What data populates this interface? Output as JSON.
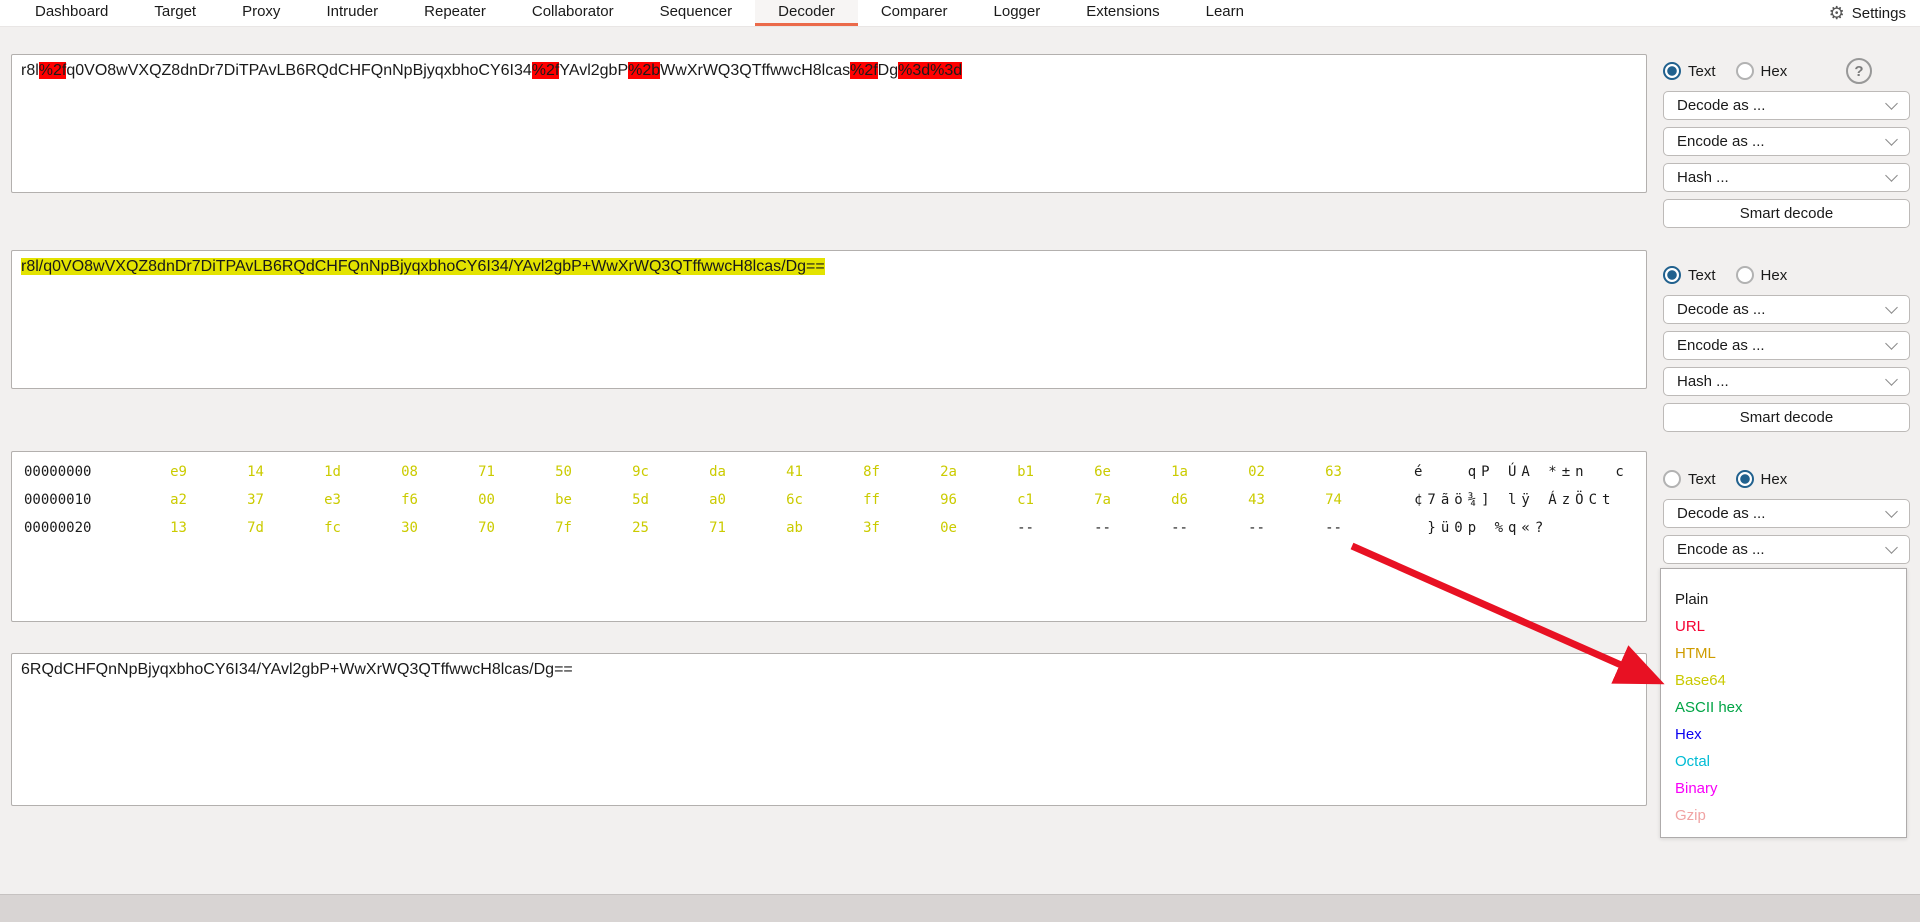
{
  "navbar": {
    "tabs": [
      {
        "label": "Dashboard",
        "active": false
      },
      {
        "label": "Target",
        "active": false
      },
      {
        "label": "Proxy",
        "active": false
      },
      {
        "label": "Intruder",
        "active": false
      },
      {
        "label": "Repeater",
        "active": false
      },
      {
        "label": "Collaborator",
        "active": false
      },
      {
        "label": "Sequencer",
        "active": false
      },
      {
        "label": "Decoder",
        "active": true
      },
      {
        "label": "Comparer",
        "active": false
      },
      {
        "label": "Logger",
        "active": false
      },
      {
        "label": "Extensions",
        "active": false
      },
      {
        "label": "Learn",
        "active": false
      }
    ],
    "settings": {
      "label": "Settings",
      "icon": "gear-icon",
      "glyph": "⚙"
    }
  },
  "controls": {
    "text_label": "Text",
    "hex_label": "Hex",
    "decode_label": "Decode as ...",
    "encode_label": "Encode as ...",
    "hash_label": "Hash ...",
    "smart_decode_label": "Smart decode",
    "help_label": "?",
    "groups": [
      {
        "selected": "text",
        "has_help": true,
        "has_hash": true,
        "has_smart": true
      },
      {
        "selected": "text",
        "has_help": false,
        "has_hash": true,
        "has_smart": true
      },
      {
        "selected": "hex",
        "has_help": false,
        "has_hash": false,
        "has_smart": false
      }
    ]
  },
  "decoder_rows": [
    {
      "type": "text",
      "segments": [
        {
          "text": "r8l",
          "highlight": "none"
        },
        {
          "text": "%2f",
          "highlight": "red"
        },
        {
          "text": "q0VO8wVXQZ8dnDr7DiTPAvLB6RQdCHFQnNpBjyqxbhoCY6I34",
          "highlight": "none"
        },
        {
          "text": "%2f",
          "highlight": "red"
        },
        {
          "text": "YAvl2gbP",
          "highlight": "none"
        },
        {
          "text": "%2b",
          "highlight": "red"
        },
        {
          "text": "WwXrWQ3QTffwwcH8lcas",
          "highlight": "none"
        },
        {
          "text": "%2f",
          "highlight": "red"
        },
        {
          "text": "Dg",
          "highlight": "none"
        },
        {
          "text": "%3d%3d",
          "highlight": "red"
        }
      ]
    },
    {
      "type": "text",
      "segments": [
        {
          "text": "r8l/q0VO8wVXQZ8dnDr7DiTPAvLB6RQdCHFQnNpBjyqxbhoCY6I34/YAvl2gbP+WwXrWQ3QTffwwcH8lcas/Dg==",
          "highlight": "yellow"
        }
      ]
    },
    {
      "type": "hex",
      "rows": [
        {
          "offset": "00000000",
          "bytes": [
            "e9",
            "14",
            "1d",
            "08",
            "71",
            "50",
            "9c",
            "da",
            "41",
            "8f",
            "2a",
            "b1",
            "6e",
            "1a",
            "02",
            "63"
          ],
          "ascii": "é   qP ÚA *±n  c"
        },
        {
          "offset": "00000010",
          "bytes": [
            "a2",
            "37",
            "e3",
            "f6",
            "00",
            "be",
            "5d",
            "a0",
            "6c",
            "ff",
            "96",
            "c1",
            "7a",
            "d6",
            "43",
            "74"
          ],
          "ascii": "¢7ãö¾] lÿ ÁzÖCt"
        },
        {
          "offset": "00000020",
          "bytes": [
            "13",
            "7d",
            "fc",
            "30",
            "70",
            "7f",
            "25",
            "71",
            "ab",
            "3f",
            "0e",
            "--",
            "--",
            "--",
            "--",
            "--"
          ],
          "ascii": " }ü0p %q«?"
        }
      ]
    },
    {
      "type": "text",
      "segments": [
        {
          "text": "6RQdCHFQnNpBjyqxbhoCY6I34/YAvl2gbP+WwXrWQ3QTffwwcH8lcas/Dg==",
          "highlight": "none"
        }
      ]
    }
  ],
  "encode_menu": {
    "items": [
      {
        "label": "Plain",
        "color": "#1a1a1a"
      },
      {
        "label": "URL",
        "color": "#f50030"
      },
      {
        "label": "HTML",
        "color": "#cf9c00"
      },
      {
        "label": "Base64",
        "color": "#c9c900"
      },
      {
        "label": "ASCII hex",
        "color": "#00a445"
      },
      {
        "label": "Hex",
        "color": "#0a00f0"
      },
      {
        "label": "Octal",
        "color": "#00bcd4"
      },
      {
        "label": "Binary",
        "color": "#f800f8"
      },
      {
        "label": "Gzip",
        "color": "#f0a3a3"
      }
    ]
  },
  "colors": {
    "accent_orange": "#eb6a4a",
    "radio_blue": "#21618e",
    "highlight_red": "#fe0000",
    "highlight_yellow": "#e3e300",
    "hex_byte": "#cbcb00",
    "arrow_red": "#e81123"
  }
}
